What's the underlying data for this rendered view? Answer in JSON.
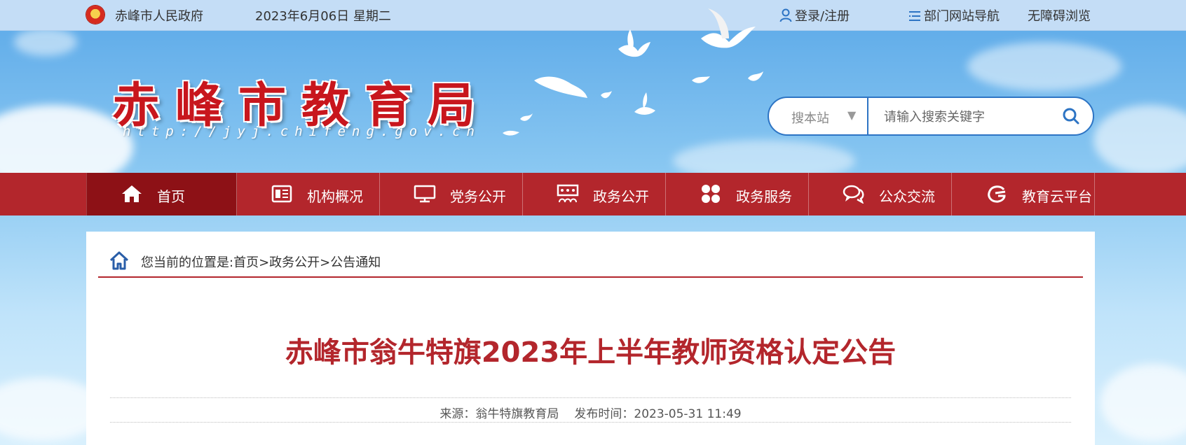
{
  "topbar": {
    "gov_name": "赤峰市人民政府",
    "date": "2023年6月06日 星期二",
    "login": "登录/注册",
    "dept_nav": "部门网站导航",
    "accessibility": "无障碍浏览"
  },
  "header": {
    "site_title": "赤峰市教育局",
    "site_url": "http://jyj.chifeng.gov.cn"
  },
  "search": {
    "scope_label": "搜本站",
    "placeholder": "请输入搜索关键字"
  },
  "nav": {
    "items": [
      {
        "label": "首页",
        "icon": "home-icon",
        "active": true
      },
      {
        "label": "机构概况",
        "icon": "newspaper-icon",
        "active": false
      },
      {
        "label": "党务公开",
        "icon": "monitor-icon",
        "active": false
      },
      {
        "label": "政务公开",
        "icon": "presentation-icon",
        "active": false
      },
      {
        "label": "政务服务",
        "icon": "grid-icon",
        "active": false
      },
      {
        "label": "公众交流",
        "icon": "chat-icon",
        "active": false
      },
      {
        "label": "教育云平台",
        "icon": "cloud-platform-icon",
        "active": false
      }
    ]
  },
  "breadcrumb": {
    "prefix": "您当前的位置是:",
    "items": [
      "首页",
      "政务公开",
      "公告通知"
    ],
    "separator": ">"
  },
  "article": {
    "title": "赤峰市翁牛特旗2023年上半年教师资格认定公告",
    "source": "来源：翁牛特旗教育局",
    "published": "发布时间：2023-05-31 11:49"
  },
  "colors": {
    "brand_red": "#b3262c",
    "nav_active": "#8d1116",
    "search_border": "#2d74c4"
  }
}
